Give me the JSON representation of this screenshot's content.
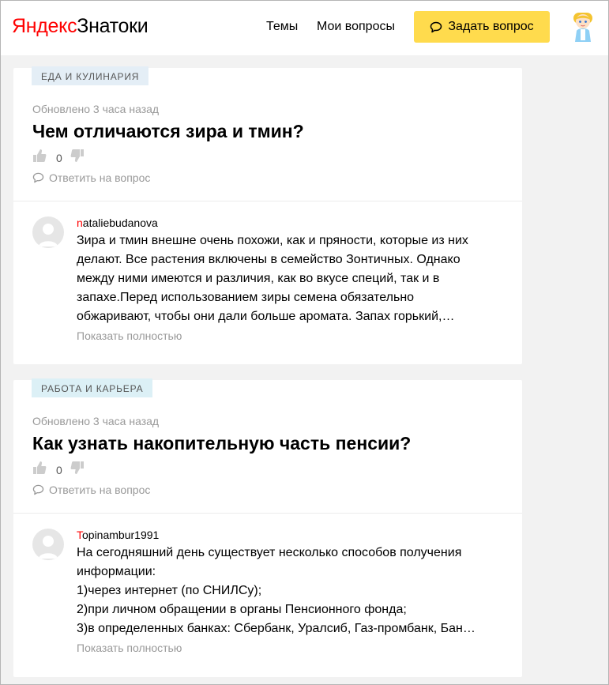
{
  "header": {
    "logo_yandex": "Яндекс",
    "logo_service": "Знатоки",
    "nav": [
      {
        "label": "Темы"
      },
      {
        "label": "Мои вопросы"
      }
    ],
    "ask_button_label": "Задать вопрос"
  },
  "questions": [
    {
      "tag": "ЕДА И КУЛИНАРИЯ",
      "tag_color": "#e4eef6",
      "updated": "Обновлено 3 часа назад",
      "title": "Чем отличаются зира и тмин?",
      "votes": "0",
      "reply_label": "Ответить на вопрос",
      "answer": {
        "author_first": "n",
        "author_rest": "ataliebudanova",
        "lines": [
          "Зира и тмин внешне очень похожи, как и пряности, которые из них",
          "делают. Все растения включены в семейство Зонтичных. Однако",
          "между ними имеются и различия, как во вкусе специй, так и в",
          "запахе.Перед использованием зиры семена обязательно",
          "обжаривают, чтобы они дали больше аромата. Запах горький,…"
        ],
        "show_more": "Показать полностью"
      }
    },
    {
      "tag": "РАБОТА И КАРЬЕРА",
      "tag_color": "#dcf0f6",
      "updated": "Обновлено 3 часа назад",
      "title": "Как узнать накопительную часть пенсии?",
      "votes": "0",
      "reply_label": "Ответить на вопрос",
      "answer": {
        "author_first": "T",
        "author_rest": "opinambur1991",
        "lines": [
          "На сегодняшний день существует несколько способов получения",
          "информации:",
          "1)через интернет (по СНИЛСу);",
          "2)при личном обращении в органы Пенсионного фонда;",
          "3)в определенных банках: Сбербанк, Уралсиб, Газ-промбанк, Бан…"
        ],
        "show_more": "Показать полностью"
      }
    }
  ]
}
